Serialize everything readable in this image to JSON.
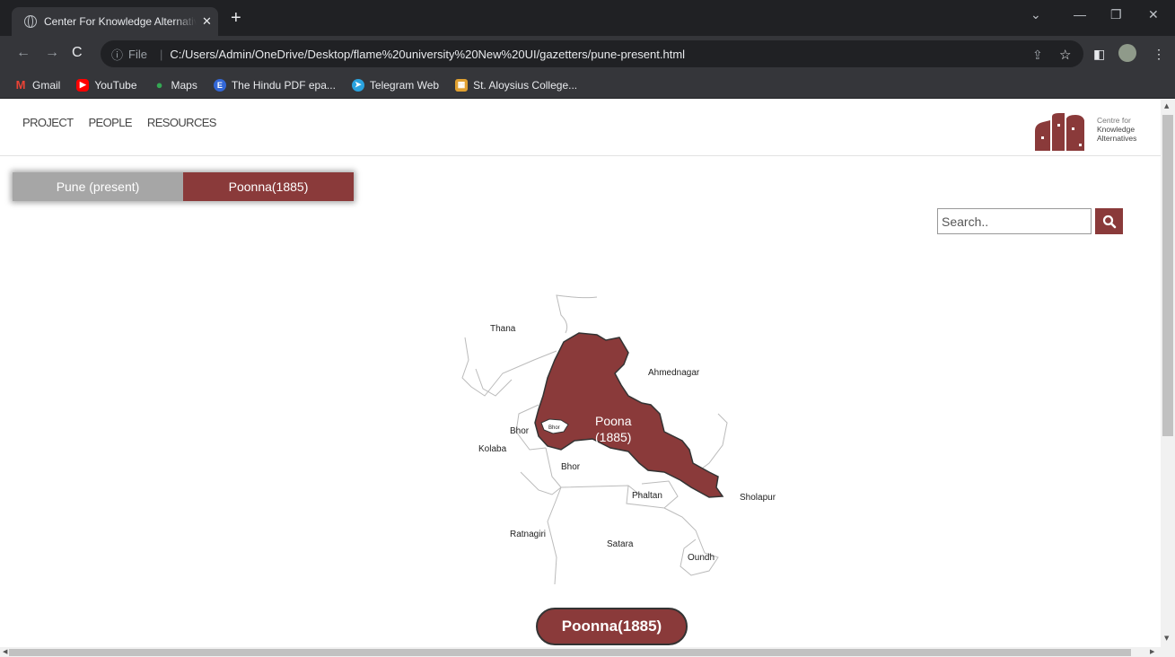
{
  "browser": {
    "tab_title": "Center For Knowledge Alternatives",
    "tab_close": "✕",
    "new_tab": "+",
    "url_prefix": "File",
    "url": "C:/Users/Admin/OneDrive/Desktop/flame%20university%20New%20UI/gazetters/pune-present.html",
    "bookmarks": [
      {
        "label": "Gmail",
        "icon": "gmail-icon",
        "color": "#ea4335"
      },
      {
        "label": "YouTube",
        "icon": "youtube-icon",
        "color": "#ff0000"
      },
      {
        "label": "Maps",
        "icon": "maps-icon",
        "color": "#34a853"
      },
      {
        "label": "The Hindu PDF epa...",
        "icon": "e-icon",
        "color": "#3367d6"
      },
      {
        "label": "Telegram Web",
        "icon": "telegram-icon",
        "color": "#2aa3df"
      },
      {
        "label": "St. Aloysius College...",
        "icon": "college-icon",
        "color": "#e0a030"
      }
    ]
  },
  "nav": {
    "items": [
      "PROJECT",
      "PEOPLE",
      "RESOURCES"
    ]
  },
  "logo": {
    "line1": "Centre for",
    "line2": "Knowledge",
    "line3": "Alternatives",
    "color": "#8a3a3a"
  },
  "toggle": {
    "present_label": "Pune (present)",
    "old_label": "Poonna(1885)"
  },
  "search": {
    "placeholder": "Search.."
  },
  "map": {
    "labels": {
      "thana": "Thana",
      "ahmednagar": "Ahmednagar",
      "bhor_left": "Bhor",
      "bhor_enclave": "Bhor",
      "kolaba": "Kolaba",
      "bhor_bottom": "Bhor",
      "poona": "Poona",
      "poona_year": "(1885)",
      "phaltan": "Phaltan",
      "sholapur": "Sholapur",
      "ratnagiri": "Ratnagiri",
      "satara": "Satara",
      "oundh": "Oundh"
    },
    "highlight_color": "#8a3a3a"
  },
  "bottom_pill": {
    "label": "Poonna(1885)"
  }
}
